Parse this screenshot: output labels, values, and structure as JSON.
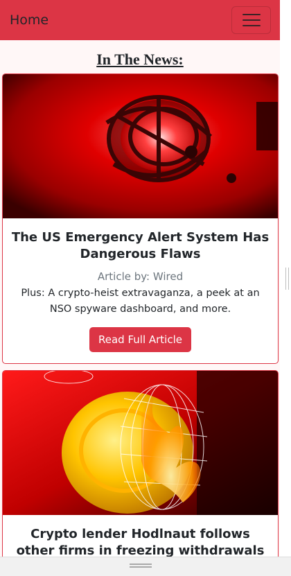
{
  "navbar": {
    "brand": "Home",
    "toggler_icon": "hamburger-menu-icon",
    "background": "#dc3545"
  },
  "page": {
    "heading": "In The News:"
  },
  "articles": [
    {
      "title": "The US Emergency Alert System Has Dangerous Flaws",
      "byline": "Article by: Wired",
      "summary": "Plus: A crypto-heist extravaganza, a peek at an NSO spyware dashboard, and more.",
      "button": "Read Full Article",
      "image": "red-alarm-light-in-cage"
    },
    {
      "title": "Crypto lender Hodlnaut follows other firms in freezing withdrawals",
      "image": "burning-gold-coin"
    }
  ],
  "colors": {
    "accent": "#dc3545",
    "page_background": "#fff7f7"
  }
}
